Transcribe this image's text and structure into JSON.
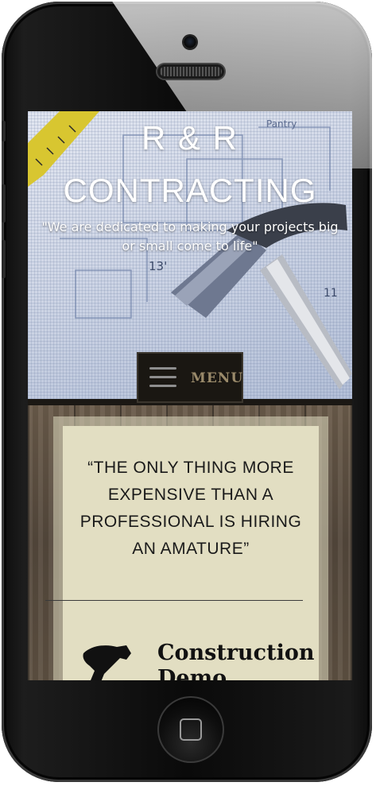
{
  "header": {
    "title_line1": "R & R",
    "title_line2": "CONTRACTING",
    "tagline": "\"We are dedicated to making your projects big or small come to life\""
  },
  "nav": {
    "menu_label": "MENU"
  },
  "quote": {
    "text": "“The only thing more expensive than a professional is hiring an amature”"
  },
  "services": [
    {
      "title": "Construction Demo",
      "icon": "hammer-icon"
    }
  ],
  "hero_image": {
    "icons": [
      "tape-measure-icon",
      "hammer-image"
    ]
  },
  "colors": {
    "quote_card_bg": "#e2dec2",
    "menu_bg": "#1a1712",
    "menu_text": "#9a8a6a",
    "wood": "#5e5142"
  }
}
